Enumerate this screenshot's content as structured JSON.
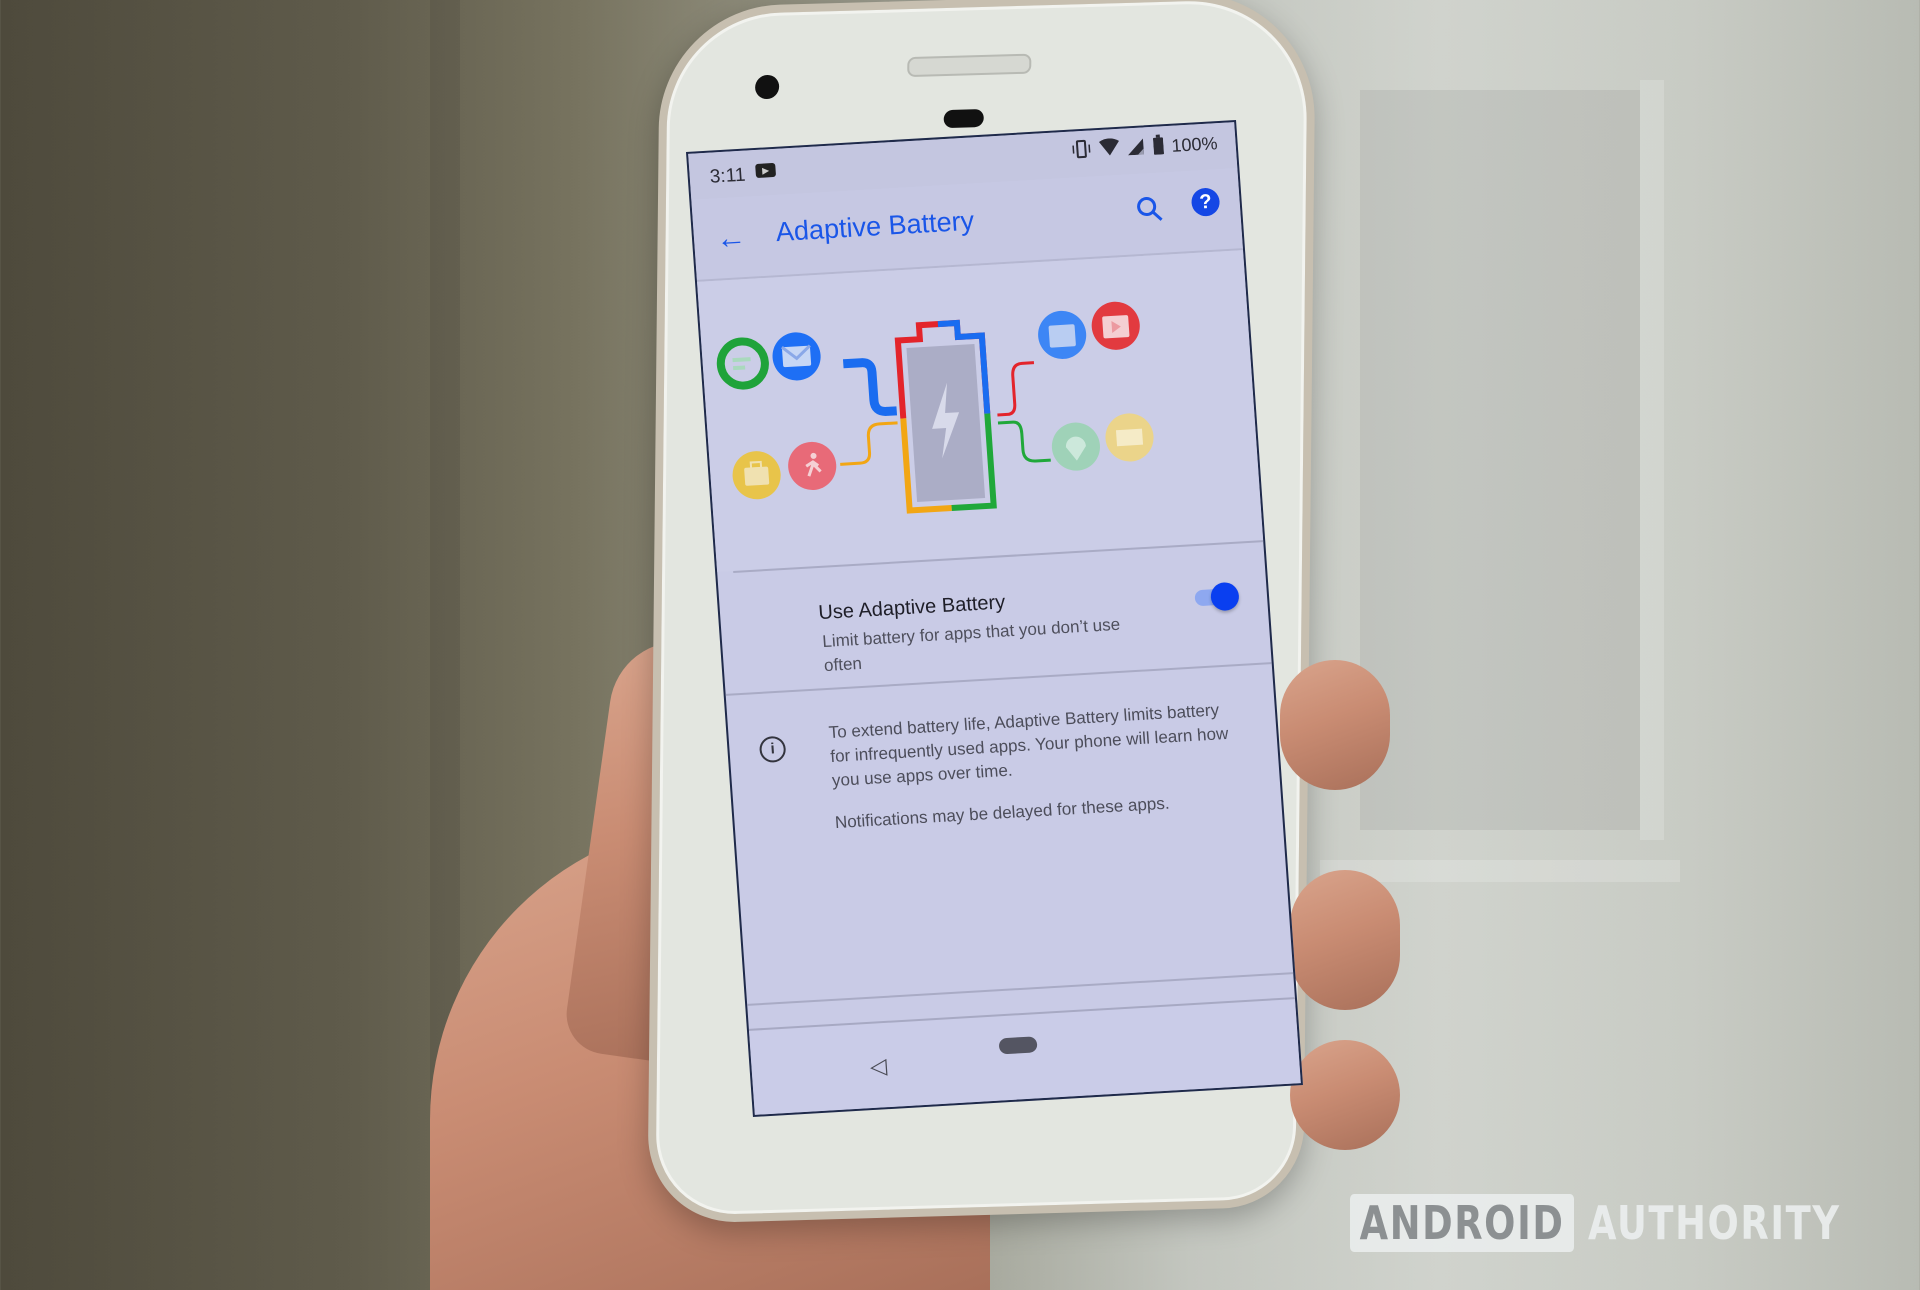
{
  "status_bar": {
    "time": "3:11",
    "notification_icon": "youtube-icon",
    "right_icons": [
      "vibrate-icon",
      "wifi-icon",
      "signal-no-data-icon",
      "battery-full-icon"
    ],
    "battery_text": "100%"
  },
  "toolbar": {
    "back_icon": "arrow-back-icon",
    "title": "Adaptive Battery",
    "search_icon": "search-icon",
    "help_icon": "help-icon"
  },
  "illustration": {
    "left_apps": [
      {
        "icon": "messages-icon",
        "color": "#1fa33a"
      },
      {
        "icon": "email-icon",
        "color": "#1e6ff5"
      },
      {
        "icon": "briefcase-icon",
        "color": "#e8c44a"
      },
      {
        "icon": "running-icon",
        "color": "#e86a78"
      }
    ],
    "right_apps": [
      {
        "icon": "calendar-icon",
        "color": "#3d86f5"
      },
      {
        "icon": "play-icon",
        "color": "#e23a3f"
      },
      {
        "icon": "location-pin-icon",
        "color": "#9fd2b8"
      },
      {
        "icon": "ticket-icon",
        "color": "#ebd48a"
      }
    ],
    "battery_colors": {
      "red": "#e3242b",
      "blue": "#1a6cf0",
      "yellow": "#f2a614",
      "green": "#20a83a"
    }
  },
  "setting": {
    "title": "Use Adaptive Battery",
    "summary": "Limit battery for apps that you don’t use often",
    "enabled": true
  },
  "info": {
    "icon": "info-icon",
    "paragraph1": "To extend battery life, Adaptive Battery limits battery for infrequently used apps. Your phone will learn how you use apps over time.",
    "paragraph2": "Notifications may be delayed for these apps."
  },
  "nav": {
    "back_icon": "nav-back-icon",
    "home_icon": "nav-home-pill-icon"
  },
  "watermark": {
    "boxed": "ANDROID",
    "text": "AUTHORITY"
  },
  "colors": {
    "accent": "#1a56e8",
    "toggle_on": "#0a3ff0",
    "screen_bg": "#c9cbe6"
  }
}
